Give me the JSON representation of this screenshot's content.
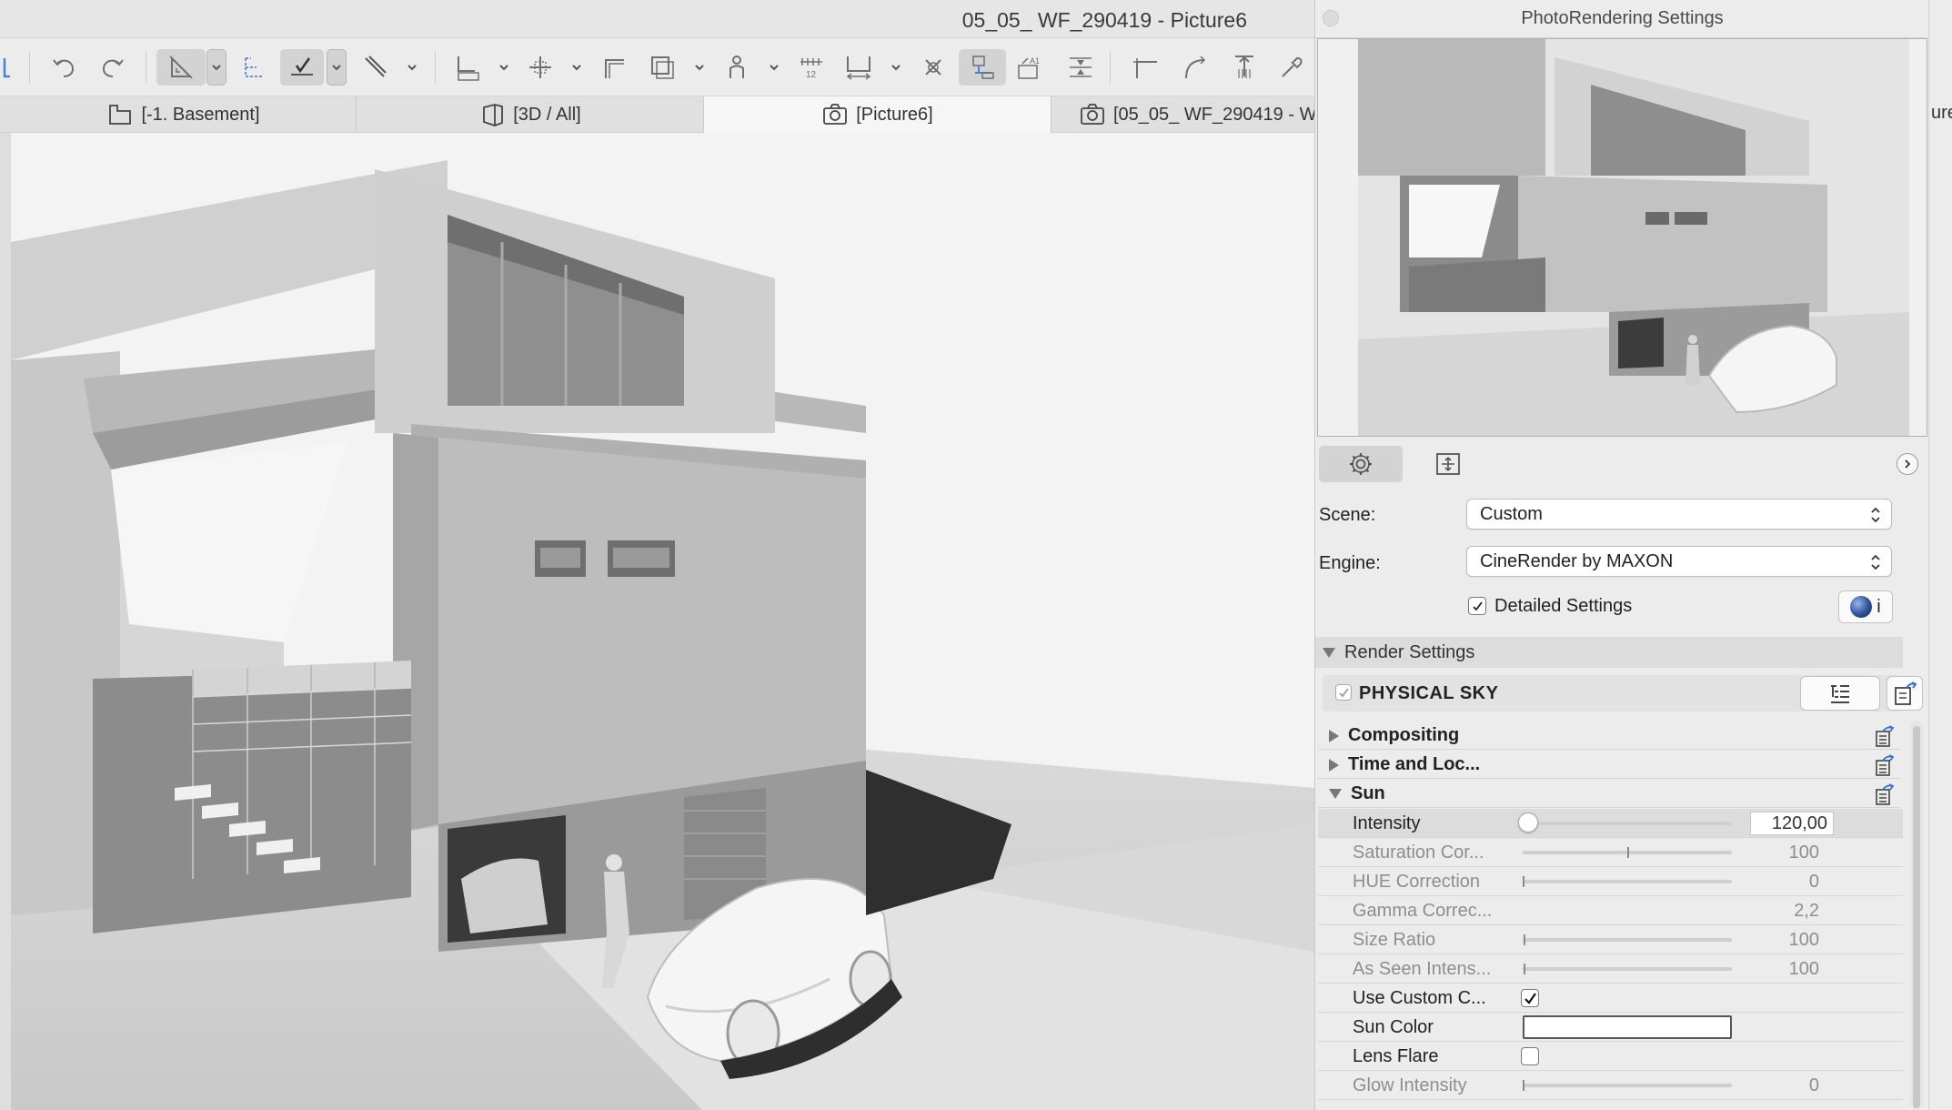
{
  "window": {
    "title": "05_05_ WF_290419 - Picture6"
  },
  "tabs": [
    {
      "label": "[-1. Basement]",
      "icon": "floor-plan-icon"
    },
    {
      "label": "[3D / All]",
      "icon": "3d-window-icon"
    },
    {
      "label": "[Picture6]",
      "icon": "camera-icon"
    },
    {
      "label": "[05_05_ WF_290419 - W",
      "icon": "camera-icon"
    }
  ],
  "right_strip_text": "ure",
  "dialog": {
    "title": "PhotoRendering Settings",
    "scene_label": "Scene:",
    "scene_value": "Custom",
    "engine_label": "Engine:",
    "engine_value": "CineRender by MAXON",
    "detailed_settings_label": "Detailed Settings",
    "info_label": "i",
    "render_settings_label": "Render Settings",
    "physical_sky_label": "PHYSICAL SKY",
    "groups": {
      "compositing": "Compositing",
      "time_location": "Time and Loc...",
      "sun": "Sun"
    },
    "sun_params": [
      {
        "label": "Intensity",
        "value": "120,00"
      },
      {
        "label": "Saturation Cor...",
        "value": "100"
      },
      {
        "label": "HUE Correction",
        "value": "0"
      },
      {
        "label": "Gamma Correc...",
        "value": "2,2"
      },
      {
        "label": "Size Ratio",
        "value": "100"
      },
      {
        "label": "As Seen Intens...",
        "value": "100"
      },
      {
        "label": "Use Custom C..."
      },
      {
        "label": "Sun Color"
      },
      {
        "label": "Lens Flare"
      },
      {
        "label": "Glow Intensity",
        "value": "0"
      }
    ]
  }
}
